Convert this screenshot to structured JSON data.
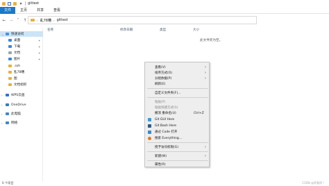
{
  "window": {
    "title": "gittest"
  },
  "ribbon": {
    "tabs": [
      "文件",
      "主页",
      "共享",
      "查看"
    ]
  },
  "address": {
    "crumbs": [
      "乱78糟",
      "gittest"
    ]
  },
  "nav": {
    "items": [
      {
        "label": "快速访问",
        "icon": "star-icon",
        "color": "#4a90e2"
      },
      {
        "label": "桌面",
        "icon": "desktop-icon",
        "color": "#3a86d6"
      },
      {
        "label": "下载",
        "icon": "download-icon",
        "color": "#3a86d6"
      },
      {
        "label": "文档",
        "icon": "document-icon",
        "color": "#9aa4b2"
      },
      {
        "label": "图片",
        "icon": "picture-icon",
        "color": "#3a86d6"
      },
      {
        "label": ".ssh",
        "icon": "folder-icon",
        "color": "#e8b13a"
      },
      {
        "label": "乱78糟",
        "icon": "folder-icon",
        "color": "#e8b13a"
      },
      {
        "label": "图",
        "icon": "folder-icon",
        "color": "#e8b13a"
      },
      {
        "label": "文档组织",
        "icon": "folder-icon",
        "color": "#e8b13a"
      },
      {
        "label": "WPS云盘",
        "icon": "cloud-icon",
        "color": "#2f6fd6"
      },
      {
        "label": "OneDrive",
        "icon": "onedrive-icon",
        "color": "#2b7cd3"
      },
      {
        "label": "此电脑",
        "icon": "computer-icon",
        "color": "#3a86d6"
      },
      {
        "label": "网络",
        "icon": "network-icon",
        "color": "#3a86d6"
      }
    ]
  },
  "columns": [
    "名称",
    "修改日期",
    "类型",
    "大小"
  ],
  "empty_text": "此文件夹为空。",
  "status": "0 个项目",
  "watermark": "CSDN @杯莫停丶",
  "context_menu": {
    "items": [
      {
        "label": "查看(V)",
        "submenu": true
      },
      {
        "label": "排序方式(O)",
        "submenu": true
      },
      {
        "label": "分组依据(P)",
        "submenu": true
      },
      {
        "label": "刷新(E)"
      },
      {
        "label": "自定义文件夹(F)..."
      },
      {
        "label": "粘贴(P)",
        "disabled": true
      },
      {
        "label": "粘贴快捷方式(S)",
        "disabled": true
      },
      {
        "label": "撤消 重命名(U)",
        "shortcut": "Ctrl+Z"
      },
      {
        "label": "Git GUI Here",
        "icon": "git-gui-icon",
        "color": "#3a9ad9"
      },
      {
        "label": "Git Bash Here",
        "icon": "git-bash-icon",
        "color": "#2b5d86"
      },
      {
        "label": "通过 Code 打开",
        "icon": "vscode-icon",
        "color": "#2a8fe0"
      },
      {
        "label": "搜索 Everything...",
        "icon": "everything-icon",
        "color": "#e07b22"
      },
      {
        "label": "授予访问权限(G)",
        "submenu": true
      },
      {
        "label": "新建(W)",
        "submenu": true
      },
      {
        "label": "属性(R)"
      }
    ]
  }
}
